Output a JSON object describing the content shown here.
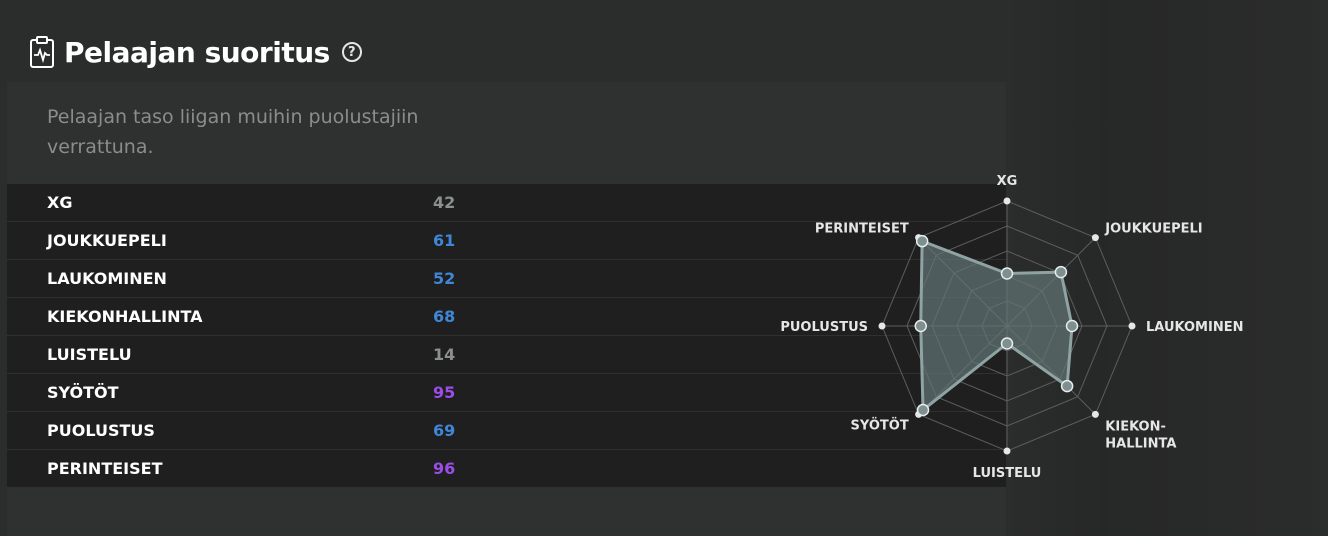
{
  "header": {
    "title": "Pelaajan suoritus",
    "help": "?"
  },
  "panel": {
    "subtitle": "Pelaajan taso liigan muihin puolustajiin verrattuna."
  },
  "stats": [
    {
      "label": "XG",
      "value": "42",
      "color": "#8c8f8f"
    },
    {
      "label": "JOUKKUEPELI",
      "value": "61",
      "color": "#3f86d6"
    },
    {
      "label": "LAUKOMINEN",
      "value": "52",
      "color": "#3f86d6"
    },
    {
      "label": "KIEKONHALLINTA",
      "value": "68",
      "color": "#3f86d6"
    },
    {
      "label": "LUISTELU",
      "value": "14",
      "color": "#8c8f8f"
    },
    {
      "label": "SYÖTÖT",
      "value": "95",
      "color": "#9b4de8"
    },
    {
      "label": "PUOLUSTUS",
      "value": "69",
      "color": "#3f86d6"
    },
    {
      "label": "PERINTEISET",
      "value": "96",
      "color": "#9b4de8"
    }
  ],
  "chart_data": {
    "type": "radar",
    "axes": [
      "XG",
      "JOUKKUEPELI",
      "LAUKOMINEN",
      "KIEKON-\nHALLINTA",
      "LUISTELU",
      "SYÖTÖT",
      "PUOLUSTUS",
      "PERINTEISET"
    ],
    "values": [
      42,
      61,
      52,
      68,
      14,
      95,
      69,
      96
    ],
    "range": [
      0,
      100
    ],
    "grid": true,
    "fill_color": "#637474",
    "line_color": "#8fa3a3"
  }
}
